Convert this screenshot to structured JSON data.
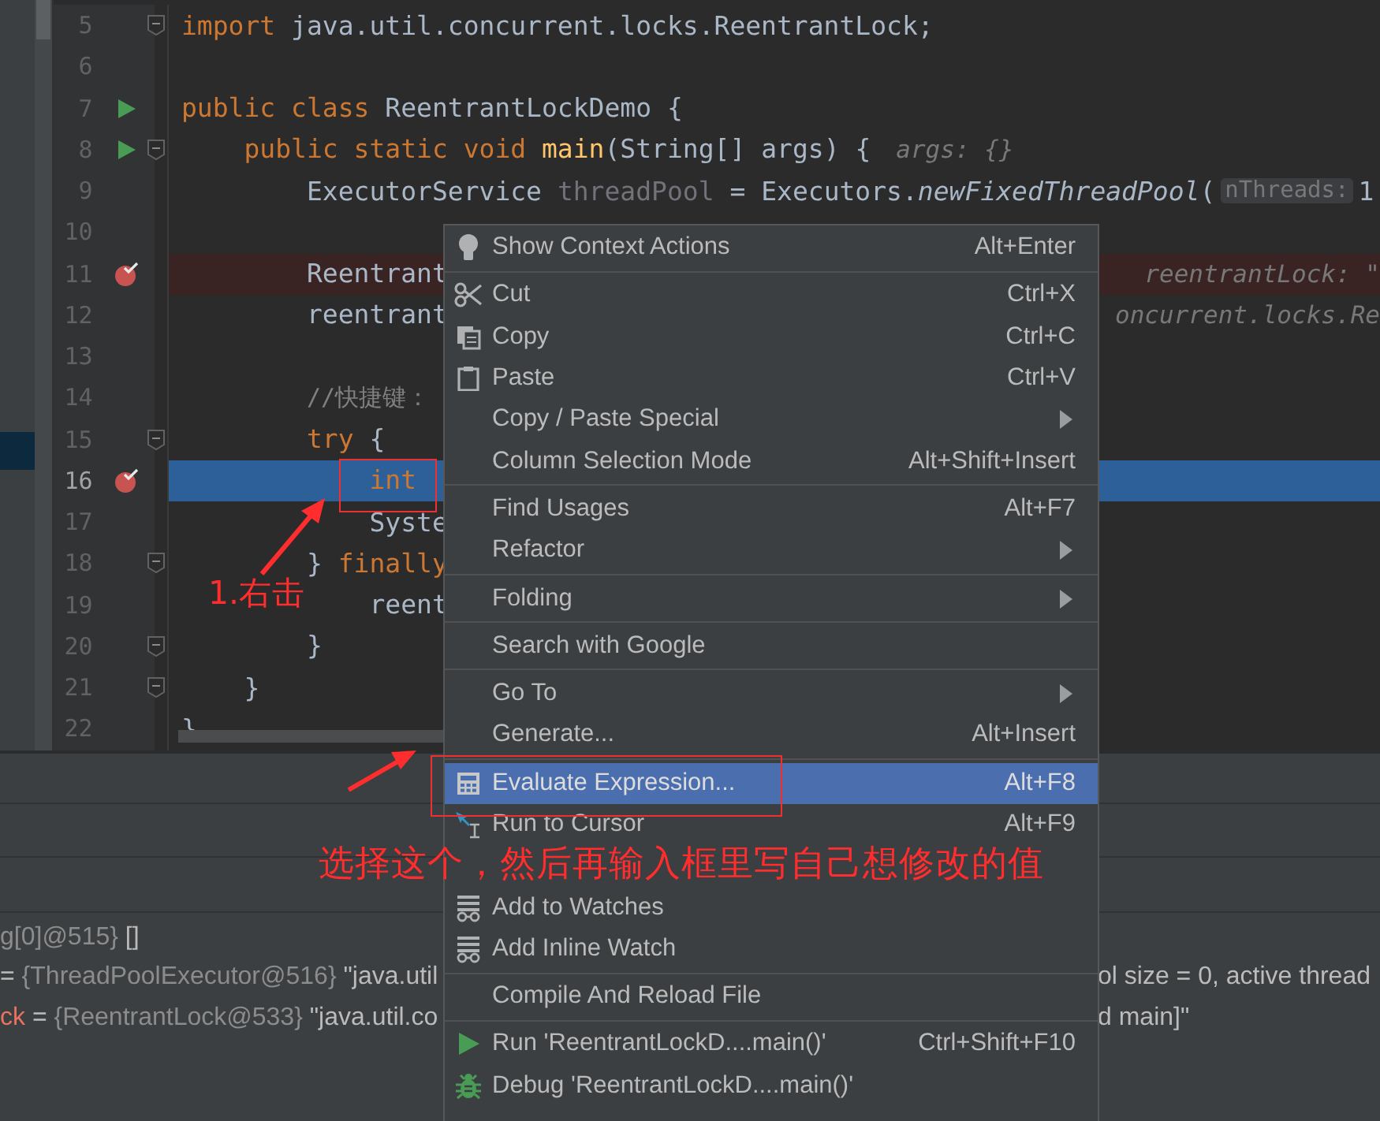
{
  "editor": {
    "lines": [
      {
        "number": "5",
        "fold": true,
        "segments": [
          {
            "kind": "code",
            "tokens": [
              {
                "kind": "keyword",
                "text": "import"
              },
              {
                "kind": "plain",
                "text": " java.util.concurrent.locks.ReentrantLock;"
              }
            ]
          }
        ]
      },
      {
        "number": "6"
      },
      {
        "number": "7",
        "run": true,
        "segments": [
          {
            "kind": "code",
            "tokens": [
              {
                "kind": "keyword",
                "text": "public class "
              },
              {
                "kind": "plain",
                "text": "ReentrantLockDemo {"
              }
            ]
          }
        ]
      },
      {
        "number": "8",
        "run": true,
        "fold": true,
        "segments": [
          {
            "kind": "code",
            "tokens": [
              {
                "kind": "keyword",
                "text": "    public static void "
              },
              {
                "kind": "method",
                "text": "main"
              },
              {
                "kind": "plain",
                "text": "(String[] args) {"
              }
            ]
          },
          {
            "kind": "value_hint",
            "text": "args: {}"
          }
        ]
      },
      {
        "number": "9",
        "segments": [
          {
            "kind": "code",
            "tokens": [
              {
                "kind": "plain",
                "text": "        ExecutorService "
              },
              {
                "kind": "unused",
                "text": "threadPool"
              },
              {
                "kind": "plain",
                "text": " = Executors."
              },
              {
                "kind": "static_method",
                "text": "newFixedThreadPool"
              },
              {
                "kind": "plain",
                "text": "("
              }
            ]
          },
          {
            "kind": "param_hint",
            "text": "nThreads:"
          },
          {
            "kind": "code",
            "tokens": [
              {
                "kind": "plain",
                "text": "1"
              }
            ]
          }
        ]
      },
      {
        "number": "10"
      },
      {
        "number": "11",
        "breakpoint": true,
        "current": false,
        "segments": [
          {
            "kind": "code",
            "tokens": [
              {
                "kind": "plain",
                "text": "        Reentrant"
              }
            ]
          }
        ],
        "right_hint": "reentrantLock: \""
      },
      {
        "number": "12",
        "segments": [
          {
            "kind": "code",
            "tokens": [
              {
                "kind": "plain",
                "text": "        reentrant"
              }
            ]
          }
        ],
        "right_hint": "oncurrent.locks.Re"
      },
      {
        "number": "13"
      },
      {
        "number": "14",
        "segments": [
          {
            "kind": "code",
            "tokens": [
              {
                "kind": "comment",
                "text": "        //快捷键："
              }
            ]
          }
        ]
      },
      {
        "number": "15",
        "fold": true,
        "segments": [
          {
            "kind": "code",
            "tokens": [
              {
                "kind": "keyword",
                "text": "        try"
              },
              {
                "kind": "plain",
                "text": " {"
              }
            ]
          }
        ]
      },
      {
        "number": "16",
        "breakpoint": true,
        "current": true,
        "segments": [
          {
            "kind": "code",
            "tokens": [
              {
                "kind": "keyword",
                "text": "            int"
              }
            ]
          }
        ]
      },
      {
        "number": "17",
        "segments": [
          {
            "kind": "code",
            "tokens": [
              {
                "kind": "plain",
                "text": "            Syste"
              }
            ]
          }
        ]
      },
      {
        "number": "18",
        "fold": true,
        "segments": [
          {
            "kind": "code",
            "tokens": [
              {
                "kind": "plain",
                "text": "        } "
              },
              {
                "kind": "keyword",
                "text": "finally"
              }
            ]
          }
        ]
      },
      {
        "number": "19",
        "segments": [
          {
            "kind": "code",
            "tokens": [
              {
                "kind": "plain",
                "text": "            reent"
              }
            ]
          }
        ]
      },
      {
        "number": "20",
        "fold": true,
        "segments": [
          {
            "kind": "code",
            "tokens": [
              {
                "kind": "plain",
                "text": "        }"
              }
            ]
          }
        ]
      },
      {
        "number": "21",
        "fold": true,
        "segments": [
          {
            "kind": "code",
            "tokens": [
              {
                "kind": "plain",
                "text": "    }"
              }
            ]
          }
        ]
      },
      {
        "number": "22",
        "segments": [
          {
            "kind": "code",
            "tokens": [
              {
                "kind": "plain",
                "text": "}"
              }
            ]
          }
        ]
      }
    ]
  },
  "variables": [
    {
      "left": [
        {
          "kind": "ref",
          "text": "g[0]@515}"
        },
        {
          "kind": "value",
          "text": " []"
        }
      ]
    },
    {
      "left": [
        {
          "kind": "op",
          "text": "= "
        },
        {
          "kind": "ref",
          "text": "{ThreadPoolExecutor@516}"
        },
        {
          "kind": "value",
          "text": " \"java.util"
        }
      ],
      "right": "ol size = 0, active thread"
    },
    {
      "left": [
        {
          "kind": "name",
          "text": "ck"
        },
        {
          "kind": "op",
          "text": " = "
        },
        {
          "kind": "ref",
          "text": "{ReentrantLock@533}"
        },
        {
          "kind": "value",
          "text": " \"java.util.co"
        }
      ],
      "right": "d main]\""
    }
  ],
  "context_menu": {
    "items": [
      {
        "kind": "item",
        "label": "Show Context Actions",
        "shortcut": "Alt+Enter",
        "selected": false
      },
      {
        "kind": "separator"
      },
      {
        "kind": "item",
        "label": "Cut",
        "shortcut": "Ctrl+X",
        "selected": false
      },
      {
        "kind": "item",
        "label": "Copy",
        "shortcut": "Ctrl+C",
        "selected": false
      },
      {
        "kind": "item",
        "label": "Paste",
        "shortcut": "Ctrl+V",
        "selected": false
      },
      {
        "kind": "item",
        "label": "Copy / Paste Special",
        "submenu": true,
        "selected": false
      },
      {
        "kind": "item",
        "label": "Column Selection Mode",
        "shortcut": "Alt+Shift+Insert",
        "selected": false
      },
      {
        "kind": "separator"
      },
      {
        "kind": "item",
        "label": "Find Usages",
        "shortcut": "Alt+F7",
        "selected": false
      },
      {
        "kind": "item",
        "label": "Refactor",
        "submenu": true,
        "selected": false
      },
      {
        "kind": "separator"
      },
      {
        "kind": "item",
        "label": "Folding",
        "submenu": true,
        "selected": false
      },
      {
        "kind": "separator"
      },
      {
        "kind": "item",
        "label": "Search with Google",
        "selected": false
      },
      {
        "kind": "separator"
      },
      {
        "kind": "item",
        "label": "Go To",
        "submenu": true,
        "selected": false
      },
      {
        "kind": "item",
        "label": "Generate...",
        "shortcut": "Alt+Insert",
        "selected": false
      },
      {
        "kind": "separator"
      },
      {
        "kind": "item",
        "label": "Evaluate Expression...",
        "shortcut": "Alt+F8",
        "selected": true
      },
      {
        "kind": "item",
        "label": "Run to Cursor",
        "shortcut": "Alt+F9",
        "selected": false
      },
      {
        "kind": "item",
        "selected": false
      },
      {
        "kind": "item",
        "label": "Add to Watches",
        "selected": false
      },
      {
        "kind": "item",
        "label": "Add Inline Watch",
        "selected": false
      },
      {
        "kind": "separator"
      },
      {
        "kind": "item",
        "label": "Compile And Reload File",
        "selected": false
      },
      {
        "kind": "separator"
      },
      {
        "kind": "item",
        "label": "Run 'ReentrantLockD....main()'",
        "shortcut": "Ctrl+Shift+F10",
        "selected": false
      },
      {
        "kind": "item",
        "label": "Debug 'ReentrantLockD....main()'",
        "selected": false
      }
    ]
  },
  "annotations": [
    {
      "text": "1.右击"
    },
    {
      "text": "选择这个，然后再输入框里写自己想修改的值"
    }
  ]
}
